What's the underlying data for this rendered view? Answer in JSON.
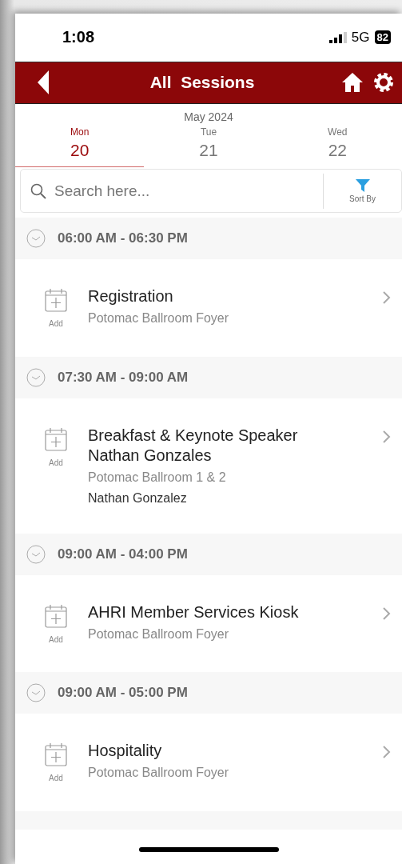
{
  "status_bar": {
    "time": "1:08",
    "network": "5G",
    "battery": "82"
  },
  "header": {
    "title": "All  Sessions"
  },
  "calendar": {
    "month": "May 2024",
    "days": [
      {
        "weekday": "Mon",
        "date": "20",
        "selected": true
      },
      {
        "weekday": "Tue",
        "date": "21",
        "selected": false
      },
      {
        "weekday": "Wed",
        "date": "22",
        "selected": false
      }
    ]
  },
  "search": {
    "placeholder": "Search here...",
    "sort_label": "Sort By"
  },
  "groups": [
    {
      "time": "06:00 AM - 06:30 PM",
      "sessions": [
        {
          "title": "Registration",
          "location": "Potomac Ballroom Foyer",
          "add_label": "Add"
        }
      ]
    },
    {
      "time": "07:30 AM - 09:00 AM",
      "sessions": [
        {
          "title": "Breakfast & Keynote Speaker Nathan Gonzales",
          "location": "Potomac Ballroom 1 & 2",
          "speaker": "Nathan Gonzalez",
          "add_label": "Add"
        }
      ]
    },
    {
      "time": "09:00 AM - 04:00 PM",
      "sessions": [
        {
          "title": "AHRI Member Services Kiosk",
          "location": "Potomac Ballroom Foyer",
          "add_label": "Add"
        }
      ]
    },
    {
      "time": "09:00 AM - 05:00 PM",
      "sessions": [
        {
          "title": "Hospitality",
          "location": "Potomac Ballroom Foyer",
          "add_label": "Add"
        }
      ]
    }
  ]
}
